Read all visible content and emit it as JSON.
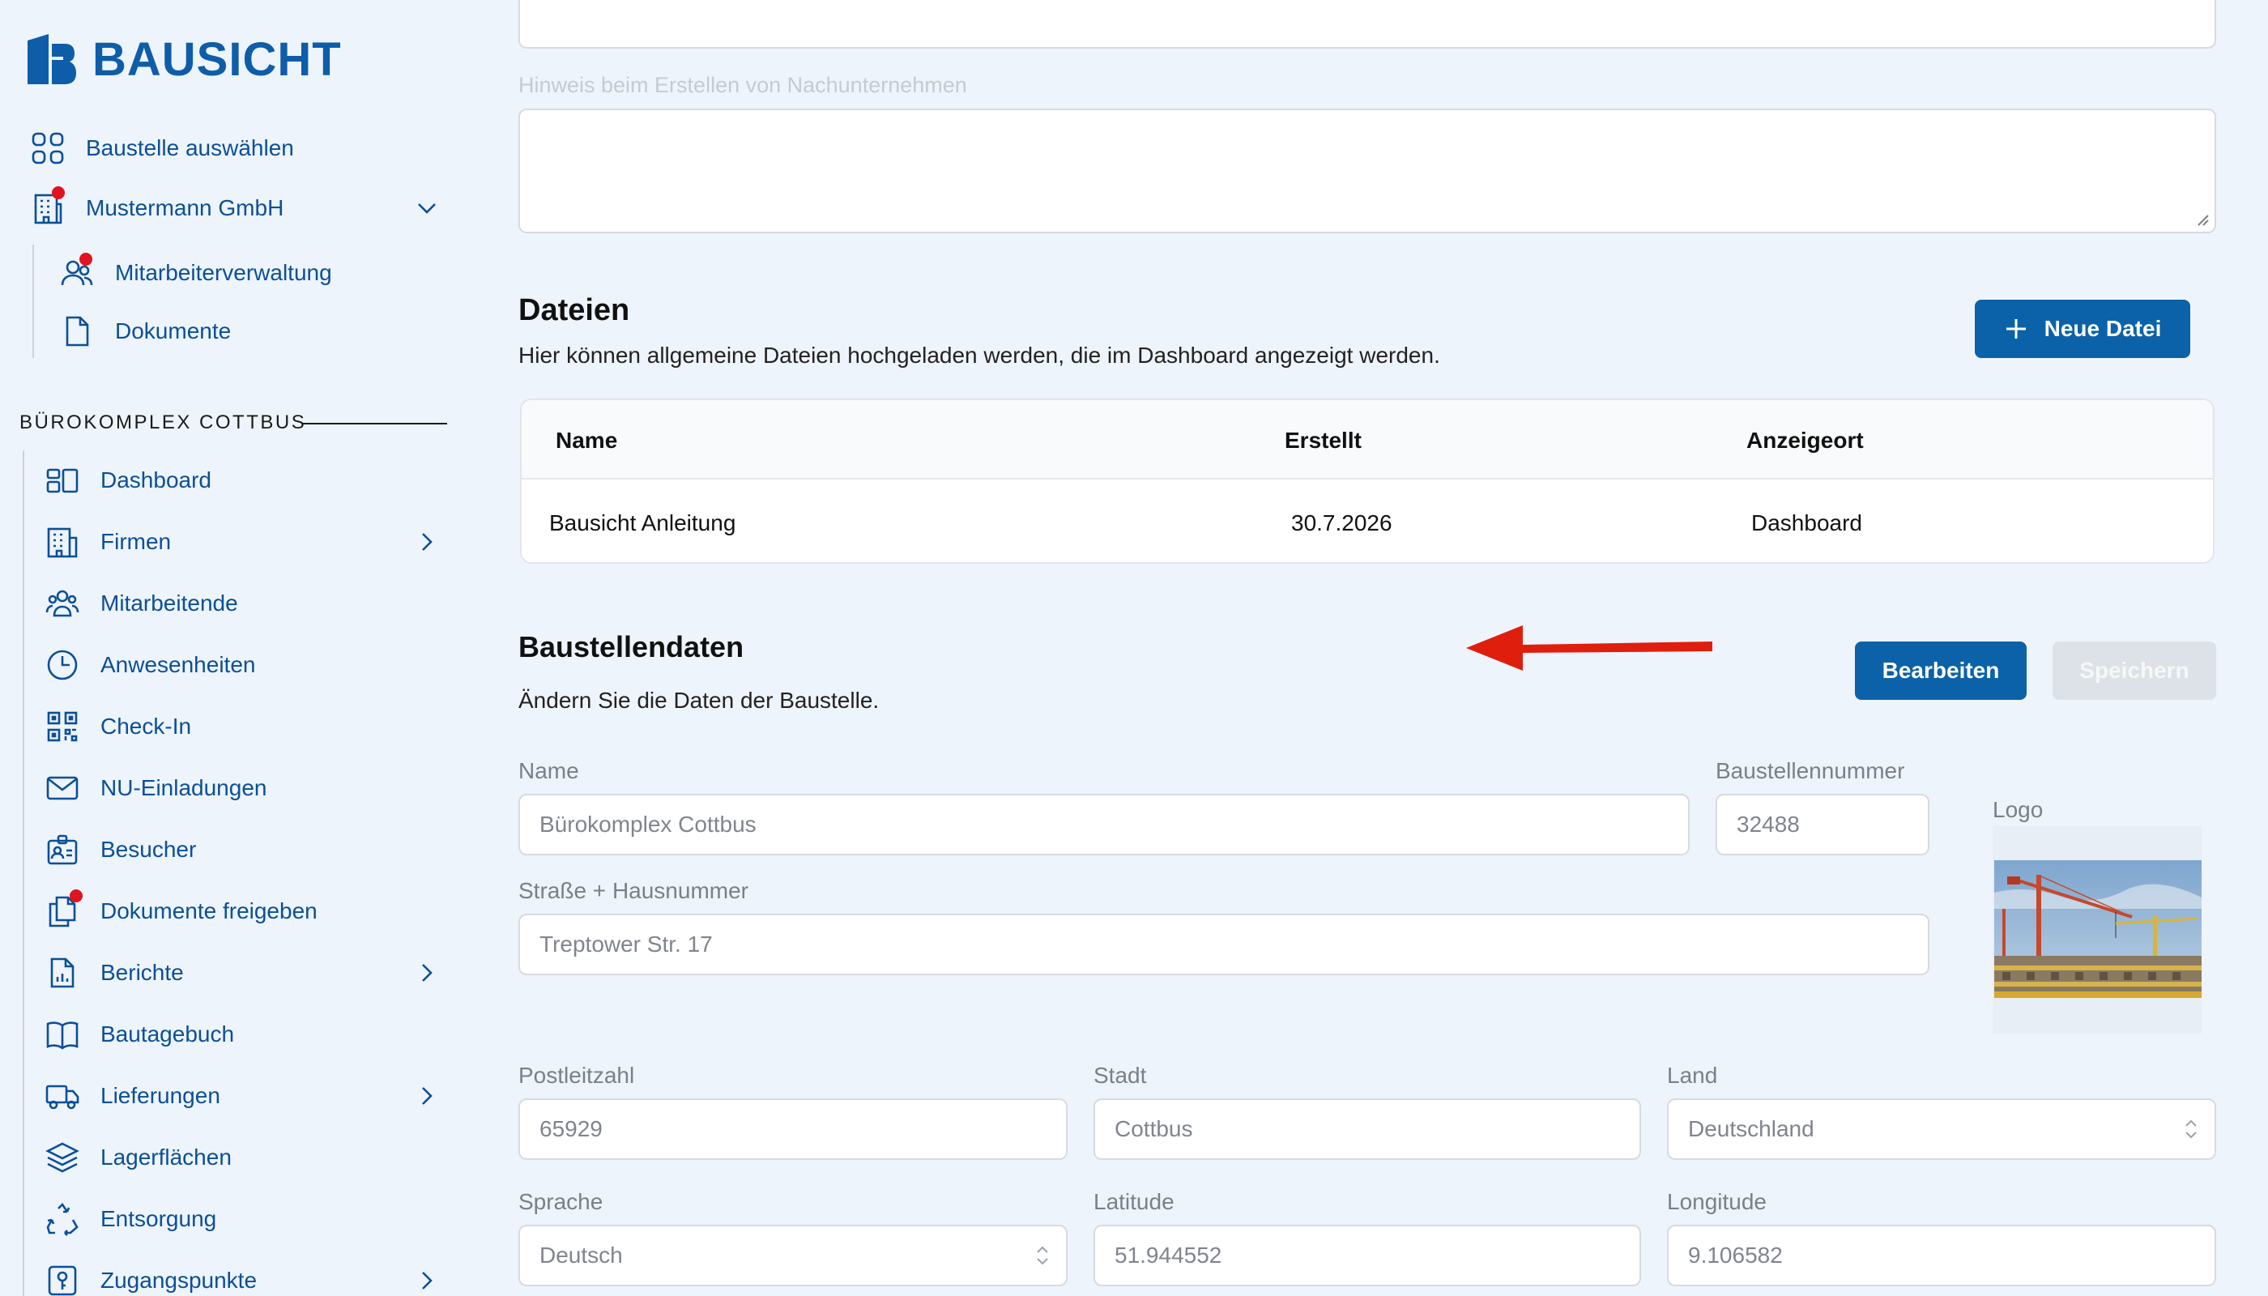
{
  "brand": {
    "name": "BAUSICHT"
  },
  "colors": {
    "primary": "#0b62a8",
    "nav_text": "#0b4f97",
    "badge": "#e0141e",
    "annotation_arrow": "#e01e0e"
  },
  "sidebar": {
    "top_items": [
      {
        "label": "Baustelle auswählen",
        "icon": "grid-icon"
      },
      {
        "label": "Mustermann GmbH",
        "icon": "building-icon",
        "badge": true,
        "expandable": true
      }
    ],
    "company_subitems": [
      {
        "label": "Mitarbeiterverwaltung",
        "icon": "users-icon",
        "badge": true
      },
      {
        "label": "Dokumente",
        "icon": "document-icon"
      }
    ],
    "section_title": "BÜROKOMPLEX COTTBUS",
    "items": [
      {
        "label": "Dashboard",
        "icon": "dashboard-icon"
      },
      {
        "label": "Firmen",
        "icon": "building-icon",
        "chevron": true
      },
      {
        "label": "Mitarbeitende",
        "icon": "people-icon"
      },
      {
        "label": "Anwesenheiten",
        "icon": "clock-icon"
      },
      {
        "label": "Check-In",
        "icon": "qr-code-icon"
      },
      {
        "label": "NU-Einladungen",
        "icon": "mail-icon"
      },
      {
        "label": "Besucher",
        "icon": "visitor-badge-icon"
      },
      {
        "label": "Dokumente freigeben",
        "icon": "documents-icon",
        "badge": true
      },
      {
        "label": "Berichte",
        "icon": "report-icon",
        "chevron": true
      },
      {
        "label": "Bautagebuch",
        "icon": "book-icon"
      },
      {
        "label": "Lieferungen",
        "icon": "truck-icon",
        "chevron": true
      },
      {
        "label": "Lagerflächen",
        "icon": "layers-icon"
      },
      {
        "label": "Entsorgung",
        "icon": "recycle-icon"
      },
      {
        "label": "Zugangspunkte",
        "icon": "key-icon",
        "chevron": true
      }
    ]
  },
  "main": {
    "hint_label": "Hinweis beim Erstellen von Nachunternehmen",
    "files": {
      "title": "Dateien",
      "subtitle": "Hier können allgemeine Dateien hochgeladen werden, die im Dashboard angezeigt werden.",
      "new_button": "Neue Datei",
      "columns": [
        "Name",
        "Erstellt",
        "Anzeigeort"
      ],
      "rows": [
        [
          "Bausicht Anleitung",
          "30.7.2026",
          "Dashboard"
        ]
      ]
    },
    "site_data": {
      "title": "Baustellendaten",
      "subtitle": "Ändern Sie die Daten der Baustelle.",
      "edit_button": "Bearbeiten",
      "save_button": "Speichern",
      "fields": {
        "name": {
          "label": "Name",
          "value": "Bürokomplex Cottbus"
        },
        "number": {
          "label": "Baustellennummer",
          "value": "32488"
        },
        "street": {
          "label": "Straße + Hausnummer",
          "value": "Treptower Str. 17"
        },
        "zip": {
          "label": "Postleitzahl",
          "value": "65929"
        },
        "city": {
          "label": "Stadt",
          "value": "Cottbus"
        },
        "country": {
          "label": "Land",
          "value": "Deutschland"
        },
        "language": {
          "label": "Sprache",
          "value": "Deutsch"
        },
        "lat": {
          "label": "Latitude",
          "value": "51.944552"
        },
        "lng": {
          "label": "Longitude",
          "value": "9.106582"
        }
      },
      "logo_label": "Logo"
    }
  }
}
